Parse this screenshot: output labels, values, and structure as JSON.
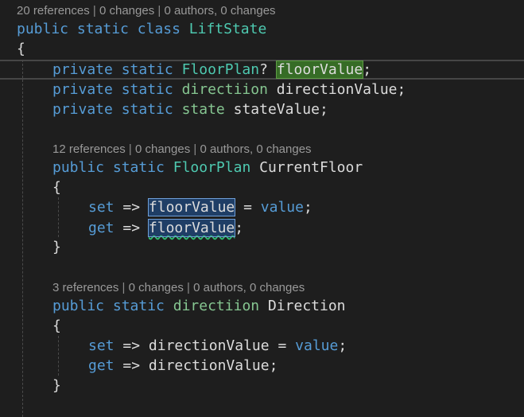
{
  "colors": {
    "background": "#1e1e1e",
    "keyword": "#569cd6",
    "type": "#4ec9b0",
    "struct_type": "#86c691",
    "identifier": "#dcdcdc",
    "lens_text": "#999999",
    "write_highlight": "#366c26",
    "reference_highlight": "#1f3e66",
    "squiggle": "#2fbf71"
  },
  "lens": {
    "class": {
      "refs": "20 references",
      "changes": "0 changes",
      "authors": "0 authors, 0 changes"
    },
    "current_floor": {
      "refs": "12 references",
      "changes": "0 changes",
      "authors": "0 authors, 0 changes"
    },
    "direction": {
      "refs": "3 references",
      "changes": "0 changes",
      "authors": "0 authors, 0 changes"
    }
  },
  "code": {
    "public": "public",
    "static": "static",
    "class": "class",
    "private": "private",
    "set": "set",
    "get": "get",
    "value": "value",
    "arrow": "=>",
    "eq": "=",
    "open_brace": "{",
    "close_brace": "}",
    "semicolon": ";",
    "question": "?",
    "class_name": "LiftState",
    "floor_plan_type": "FloorPlan",
    "direction_type": "directiion",
    "state_type": "state",
    "floor_value": "floorValue",
    "direction_value": "directionValue",
    "state_value": "stateValue",
    "current_floor": "CurrentFloor",
    "direction_prop": "Direction"
  }
}
